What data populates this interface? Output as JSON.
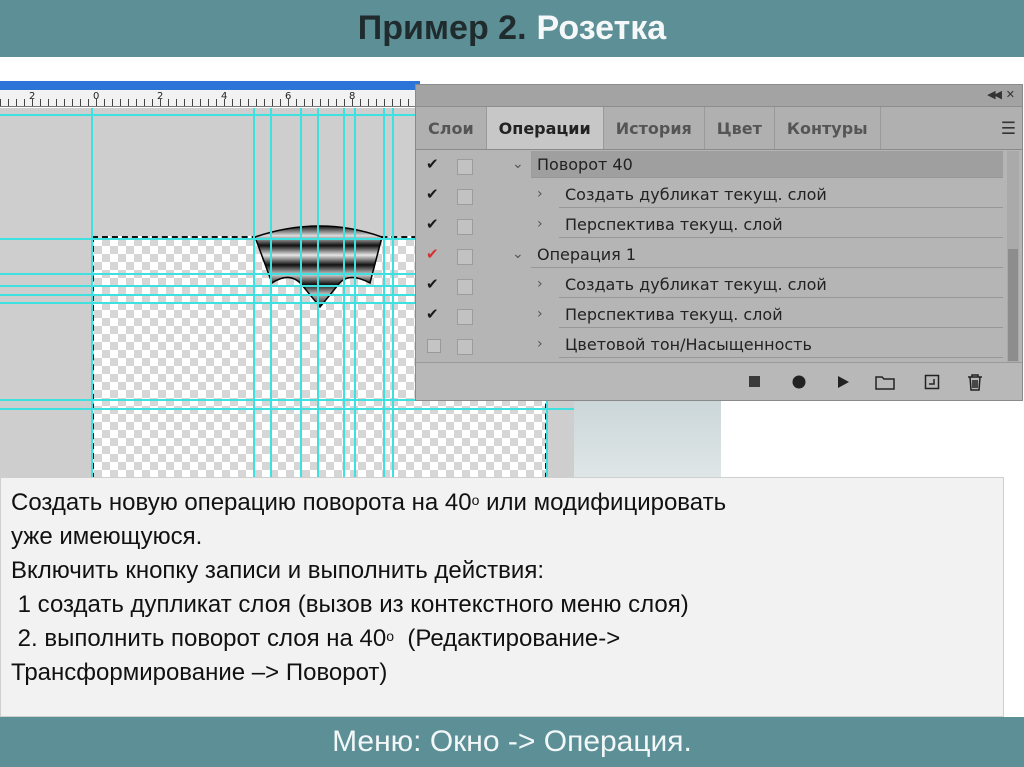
{
  "title": {
    "main": "Пример 2.",
    "accent": "Розетка"
  },
  "ruler": {
    "labels": [
      "2",
      "0",
      "2",
      "4",
      "6",
      "8"
    ]
  },
  "panel": {
    "tabs": [
      "Слои",
      "Операции",
      "История",
      "Цвет",
      "Контуры"
    ],
    "active_tab": "Операции",
    "rows": [
      {
        "checked": true,
        "red": false,
        "expand": "open",
        "label": "Поворот 40",
        "level": 0
      },
      {
        "checked": true,
        "red": false,
        "expand": "closed",
        "label": "Создать дубликат текущ. слой",
        "level": 1
      },
      {
        "checked": true,
        "red": false,
        "expand": "closed",
        "label": "Перспектива текущ. слой",
        "level": 1
      },
      {
        "checked": true,
        "red": true,
        "expand": "open",
        "label": "Операция 1",
        "level": 0
      },
      {
        "checked": true,
        "red": false,
        "expand": "closed",
        "label": "Создать дубликат текущ. слой",
        "level": 1
      },
      {
        "checked": true,
        "red": false,
        "expand": "closed",
        "label": "Перспектива текущ. слой",
        "level": 1
      },
      {
        "checked": false,
        "red": false,
        "expand": "closed",
        "label": "Цветовой тон/Насыщенность",
        "level": 1
      }
    ],
    "toolbar_icons": [
      "stop-icon",
      "record-icon",
      "play-icon",
      "folder-icon",
      "new-action-icon",
      "trash-icon"
    ]
  },
  "body": {
    "line1_a": "Создать новую операцию поворота на 40",
    "line1_sup": "о",
    "line1_b": " или модифицировать",
    "line2": "уже имеющуюся.",
    "line3": "Включить кнопку записи и выполнить действия:",
    "line4": " 1 создать дупликат слоя (вызов из контекстного меню слоя)",
    "line5_a": " 2. выполнить поворот слоя на 40",
    "line5_sup": "о",
    "line5_b": "  (Редактирование->",
    "line6": "Трансформирование –> Поворот)"
  },
  "footer": "Меню: Окно -> Операция.",
  "colors": {
    "accent": "#5d8f97",
    "guides": "#3fe0e0",
    "ruler_bar": "#2d74d8"
  }
}
